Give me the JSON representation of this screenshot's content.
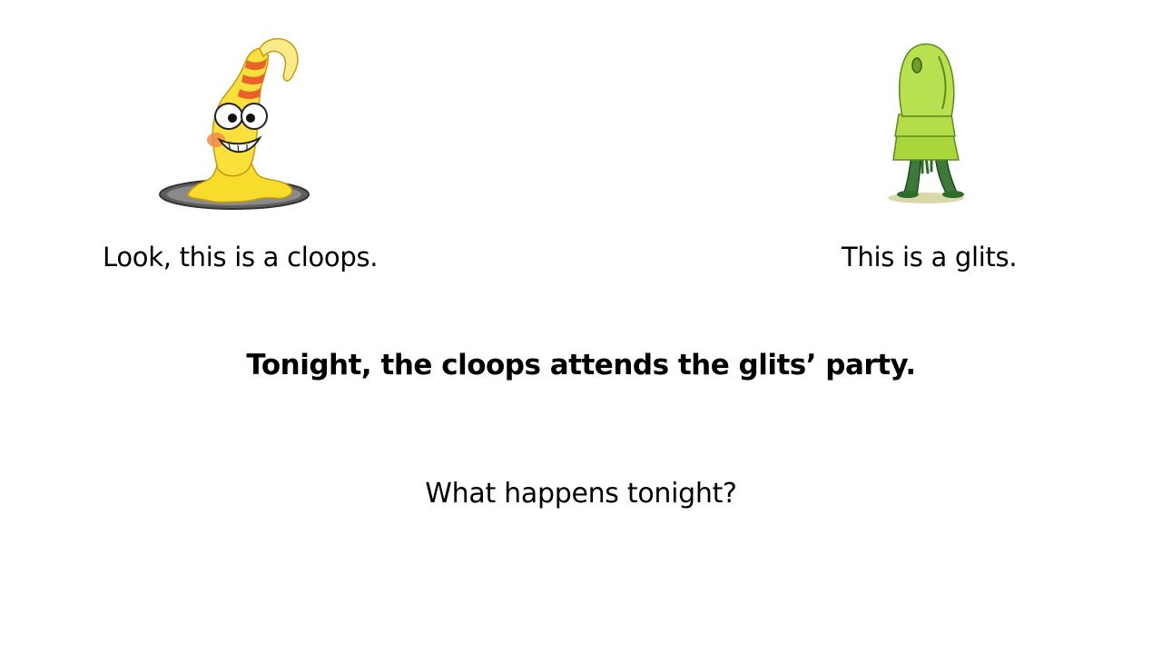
{
  "slide": {
    "left_caption": "Look, this is a cloops.",
    "right_caption": "This is a glits.",
    "statement": "Tonight, the cloops attends the glits’ party.",
    "question": "What happens tonight?"
  },
  "characters": [
    {
      "name": "cloops",
      "icon": "cloops-illustration",
      "colors": {
        "body": "#f6e23a",
        "stripes": "#e8622a",
        "puddle": "#6c6c6c"
      }
    },
    {
      "name": "glits",
      "icon": "glits-illustration",
      "colors": {
        "body": "#a9d63b",
        "legs": "#3d7a3a"
      }
    }
  ]
}
